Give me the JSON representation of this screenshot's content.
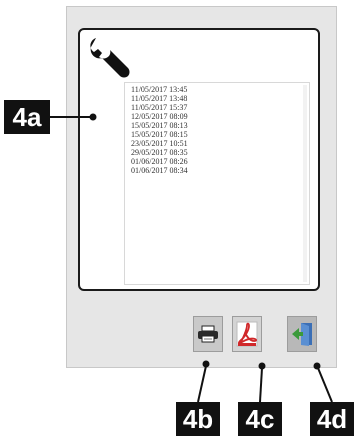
{
  "log": {
    "entries": [
      "11/05/2017 13:45",
      "11/05/2017 13:48",
      "11/05/2017 15:37",
      "12/05/2017 08:09",
      "15/05/2017 08:13",
      "15/05/2017 08:15",
      "23/05/2017 10:51",
      "29/05/2017 08:35",
      "01/06/2017 08:26",
      "01/06/2017 08:34"
    ]
  },
  "callouts": {
    "a": "4a",
    "b": "4b",
    "c": "4c",
    "d": "4d"
  },
  "icons": {
    "header": "wrench-icon",
    "print": "printer-icon",
    "pdf": "pdf-icon",
    "exit": "exit-door-icon"
  },
  "colors": {
    "pdf_red": "#d0282a",
    "exit_green": "#3a9a3a",
    "exit_blue": "#3b6fb6",
    "callout_bg": "#111111"
  }
}
